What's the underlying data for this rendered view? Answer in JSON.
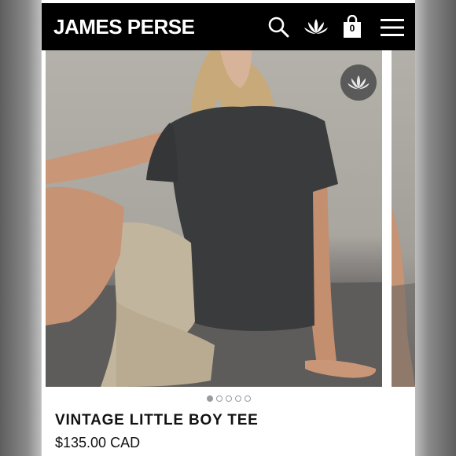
{
  "header": {
    "brand": "JAMES PERSE",
    "cart_count": "0",
    "icons": [
      "search-icon",
      "lotus-icon",
      "shopping-bag-icon",
      "hamburger-menu-icon"
    ]
  },
  "carousel": {
    "slide_count": 5,
    "active_index": 0,
    "badge_icon": "lotus-icon"
  },
  "product": {
    "name": "VINTAGE LITTLE BOY TEE",
    "price": "$135.00 CAD"
  },
  "colors": {
    "header_bg": "#000000",
    "header_fg": "#ffffff",
    "text": "#111111"
  }
}
